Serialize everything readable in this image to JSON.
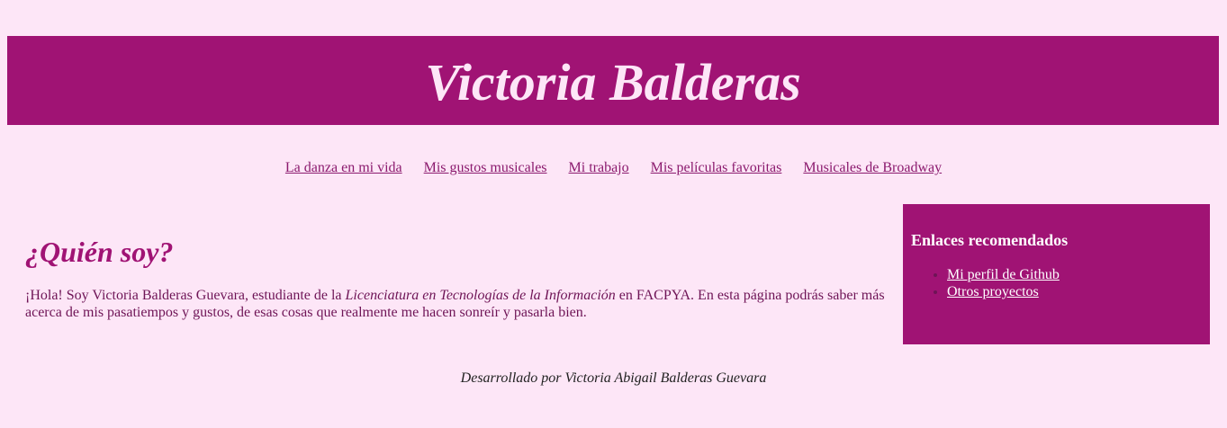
{
  "header": {
    "title": "Victoria Balderas"
  },
  "nav": {
    "items": [
      {
        "label": "La danza en mi vida"
      },
      {
        "label": "Mis gustos musicales"
      },
      {
        "label": "Mi trabajo"
      },
      {
        "label": "Mis películas favoritas"
      },
      {
        "label": "Musicales de Broadway"
      }
    ]
  },
  "main": {
    "heading": "¿Quién soy?",
    "intro_before": "¡Hola! Soy Victoria Balderas Guevara, estudiante de la ",
    "intro_emphasis": "Licenciatura en Tecnologías de la Información",
    "intro_after": " en FACPYA. En esta página podrás saber más acerca de mis pasatiempos y gustos, de esas cosas que realmente me hacen sonreír y pasarla bien."
  },
  "aside": {
    "heading": "Enlaces recomendados",
    "links": [
      {
        "label": "Mi perfil de Github"
      },
      {
        "label": "Otros proyectos"
      }
    ]
  },
  "footer": {
    "text": "Desarrollado por Victoria Abigail Balderas Guevara"
  },
  "colors": {
    "background": "#fde6f7",
    "accent": "#a01374",
    "text": "#6e1456"
  }
}
